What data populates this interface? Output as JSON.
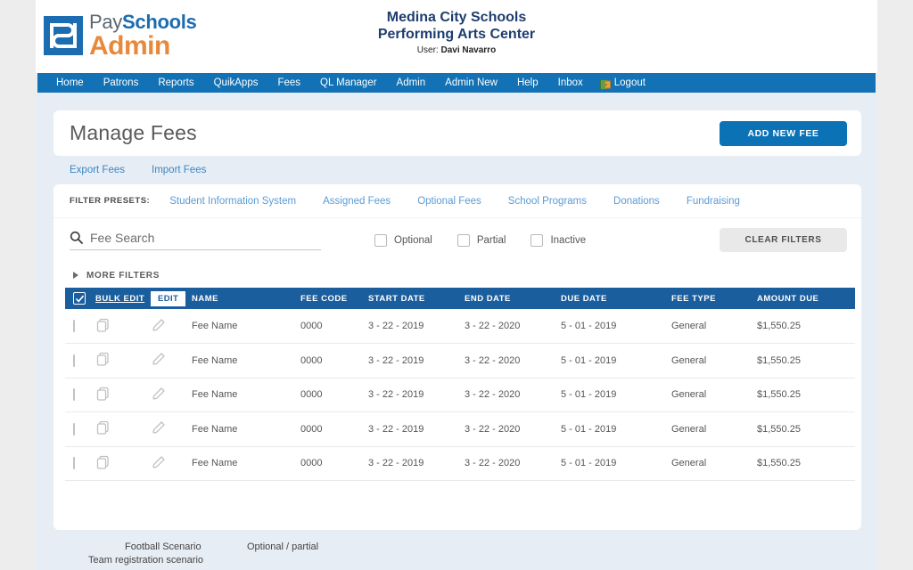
{
  "brand": {
    "logo_icon": "payschools-ps-monogram-icon",
    "word_pay": "Pay",
    "word_schools": "Schools",
    "word_admin": "Admin"
  },
  "header": {
    "district_line1": "Medina City Schools",
    "district_line2": "Performing Arts Center",
    "user_label": "User:",
    "user_name": "Davi Navarro"
  },
  "nav": {
    "items": [
      {
        "label": "Home"
      },
      {
        "label": "Patrons"
      },
      {
        "label": "Reports"
      },
      {
        "label": "QuikApps"
      },
      {
        "label": "Fees"
      },
      {
        "label": "QL Manager"
      },
      {
        "label": "Admin"
      },
      {
        "label": "Admin New"
      },
      {
        "label": "Help"
      },
      {
        "label": "Inbox"
      }
    ],
    "logout": {
      "label": "Logout",
      "icon": "exit-door-icon"
    }
  },
  "page": {
    "title": "Manage Fees",
    "add_new_fee_label": "ADD NEW FEE"
  },
  "subbar": {
    "export_label": "Export Fees",
    "import_label": "Import Fees"
  },
  "filters": {
    "presets_label": "FILTER PRESETS:",
    "presets": [
      {
        "label": "Student Information System"
      },
      {
        "label": "Assigned Fees"
      },
      {
        "label": "Optional Fees"
      },
      {
        "label": "School Programs"
      },
      {
        "label": "Donations"
      },
      {
        "label": "Fundraising"
      }
    ],
    "search": {
      "icon": "search-icon",
      "value": "",
      "placeholder": "Fee Search"
    },
    "checkboxes": [
      {
        "label": "Optional",
        "checked": false
      },
      {
        "label": "Partial",
        "checked": false
      },
      {
        "label": "Inactive",
        "checked": false
      }
    ],
    "clear_filters_label": "CLEAR FILTERS",
    "more_filters_label": "MORE FILTERS",
    "more_filters_icon": "caret-right-icon"
  },
  "table": {
    "header": {
      "select_all_checked": true,
      "bulk_edit_label": "BULK EDIT",
      "edit_label": "EDIT",
      "columns": [
        {
          "key": "name",
          "label": "NAME"
        },
        {
          "key": "fee_code",
          "label": "FEE CODE"
        },
        {
          "key": "start_date",
          "label": "START DATE"
        },
        {
          "key": "end_date",
          "label": "END DATE"
        },
        {
          "key": "due_date",
          "label": "DUE DATE"
        },
        {
          "key": "fee_type",
          "label": "FEE TYPE"
        },
        {
          "key": "amount_due",
          "label": "AMOUNT DUE"
        }
      ]
    },
    "row_icons": {
      "copy": "copy-icon",
      "edit": "pencil-icon"
    },
    "rows": [
      {
        "checked": false,
        "name": "Fee Name",
        "fee_code": "0000",
        "start_date": "3 - 22 - 2019",
        "end_date": "3 - 22 - 2020",
        "due_date": "5 - 01 - 2019",
        "fee_type": "General",
        "amount_due": "$1,550.25"
      },
      {
        "checked": false,
        "name": "Fee Name",
        "fee_code": "0000",
        "start_date": "3 - 22 - 2019",
        "end_date": "3 - 22 - 2020",
        "due_date": "5 - 01 - 2019",
        "fee_type": "General",
        "amount_due": "$1,550.25"
      },
      {
        "checked": false,
        "name": "Fee Name",
        "fee_code": "0000",
        "start_date": "3 - 22 - 2019",
        "end_date": "3 - 22 - 2020",
        "due_date": "5 - 01 - 2019",
        "fee_type": "General",
        "amount_due": "$1,550.25"
      },
      {
        "checked": false,
        "name": "Fee Name",
        "fee_code": "0000",
        "start_date": "3 - 22 - 2019",
        "end_date": "3 - 22 - 2020",
        "due_date": "5 - 01 - 2019",
        "fee_type": "General",
        "amount_due": "$1,550.25"
      },
      {
        "checked": false,
        "name": "Fee Name",
        "fee_code": "0000",
        "start_date": "3 - 22 - 2019",
        "end_date": "3 - 22 - 2020",
        "due_date": "5 - 01 - 2019",
        "fee_type": "General",
        "amount_due": "$1,550.25"
      }
    ]
  },
  "notes": {
    "scenario_line1": "Football Scenario",
    "scenario_line2": "Team registration scenario",
    "scenario_right": "Optional / partial"
  },
  "colors": {
    "nav_blue": "#1272b5",
    "table_header_blue": "#1b5e9e",
    "primary_button_blue": "#0b72b5",
    "brand_orange": "#e8883a",
    "brand_blue": "#1b6cb0",
    "page_background": "#e7edf4",
    "link_blue": "#3b86c4"
  }
}
